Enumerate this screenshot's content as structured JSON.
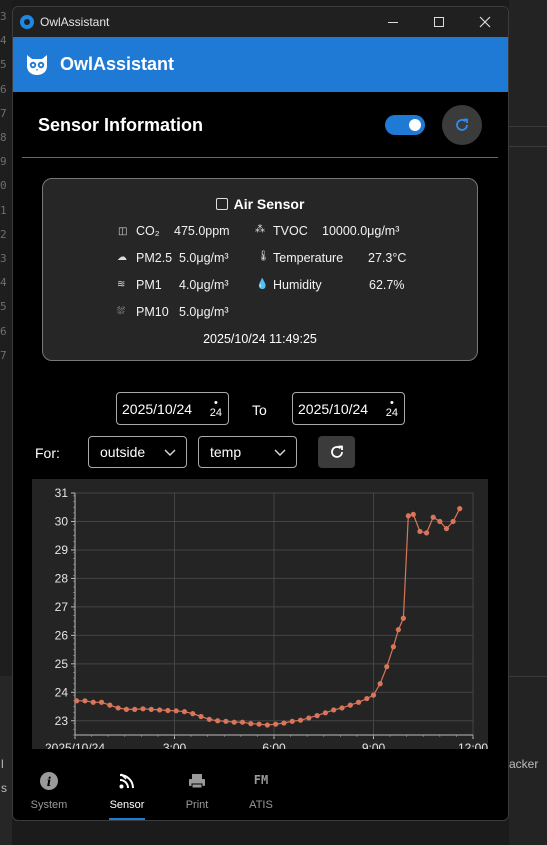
{
  "background": {
    "line_numbers": [
      "3",
      "4",
      "5",
      "6",
      "7",
      "8",
      "9",
      "0",
      "1",
      "2",
      "3",
      "4",
      "5",
      "6",
      "7"
    ],
    "bottom_text_left": "l",
    "bottom_text_left2": "s",
    "right_text": "acker"
  },
  "window": {
    "title": "OwlAssistant"
  },
  "app": {
    "title": "OwlAssistant",
    "accent": "#1e7ad4"
  },
  "section": {
    "title": "Sensor Information",
    "toggle_on": true
  },
  "card": {
    "title": "Air Sensor",
    "metrics": [
      {
        "icon": "co2-icon",
        "label": "CO₂",
        "value": "475.0ppm"
      },
      {
        "icon": "tvoc-icon",
        "label": "TVOC",
        "value": "10000.0μg/m³"
      },
      {
        "icon": "cloud-icon",
        "label": "PM2.5",
        "value": "5.0μg/m³"
      },
      {
        "icon": "thermometer-icon",
        "label": "Temperature",
        "value": "27.3°C"
      },
      {
        "icon": "haze-icon",
        "label": "PM1",
        "value": "4.0μg/m³"
      },
      {
        "icon": "humidity-icon",
        "label": "Humidity",
        "value": "62.7%"
      },
      {
        "icon": "pm10-icon",
        "label": "PM10",
        "value": "5.0μg/m³"
      }
    ],
    "timestamp": "2025/10/24 11:49:25"
  },
  "filters": {
    "from_date": "2025/10/24",
    "from_spin": "24",
    "to_label": "To",
    "to_date": "2025/10/24",
    "to_spin": "24",
    "for_label": "For:",
    "location": "outside",
    "metric": "temp"
  },
  "chart_data": {
    "type": "line",
    "color": "#d9755a",
    "xticks": [
      "2025/10/24",
      "3:00",
      "6:00",
      "9:00",
      "12:00"
    ],
    "xlim": [
      0,
      12
    ],
    "ylim": [
      22.5,
      31
    ],
    "yticks": [
      23,
      24,
      25,
      26,
      27,
      28,
      29,
      30,
      31
    ],
    "grid": true,
    "x": [
      0.05,
      0.3,
      0.55,
      0.8,
      1.05,
      1.3,
      1.55,
      1.8,
      2.05,
      2.3,
      2.55,
      2.8,
      3.05,
      3.3,
      3.55,
      3.8,
      4.05,
      4.3,
      4.55,
      4.8,
      5.05,
      5.3,
      5.55,
      5.8,
      6.05,
      6.3,
      6.55,
      6.8,
      7.05,
      7.3,
      7.55,
      7.8,
      8.05,
      8.3,
      8.55,
      8.8,
      9.0,
      9.2,
      9.4,
      9.6,
      9.75,
      9.9,
      10.05,
      10.2,
      10.4,
      10.6,
      10.8,
      11.0,
      11.2,
      11.4,
      11.6
    ],
    "y": [
      23.7,
      23.7,
      23.65,
      23.65,
      23.55,
      23.45,
      23.4,
      23.4,
      23.42,
      23.4,
      23.38,
      23.36,
      23.35,
      23.32,
      23.25,
      23.15,
      23.05,
      23.0,
      22.98,
      22.95,
      22.95,
      22.9,
      22.88,
      22.85,
      22.88,
      22.92,
      22.98,
      23.02,
      23.1,
      23.18,
      23.28,
      23.38,
      23.45,
      23.55,
      23.65,
      23.78,
      23.9,
      24.3,
      24.9,
      25.6,
      26.2,
      26.6,
      30.2,
      30.25,
      29.65,
      29.6,
      30.15,
      30.0,
      29.75,
      30.0,
      30.45
    ]
  },
  "nav": {
    "items": [
      {
        "label": "System",
        "icon": "info-icon"
      },
      {
        "label": "Sensor",
        "icon": "sensor-icon",
        "active": true
      },
      {
        "label": "Print",
        "icon": "printer-icon"
      },
      {
        "label": "ATIS",
        "icon": "fm-icon",
        "icon_text": "FM"
      }
    ]
  }
}
